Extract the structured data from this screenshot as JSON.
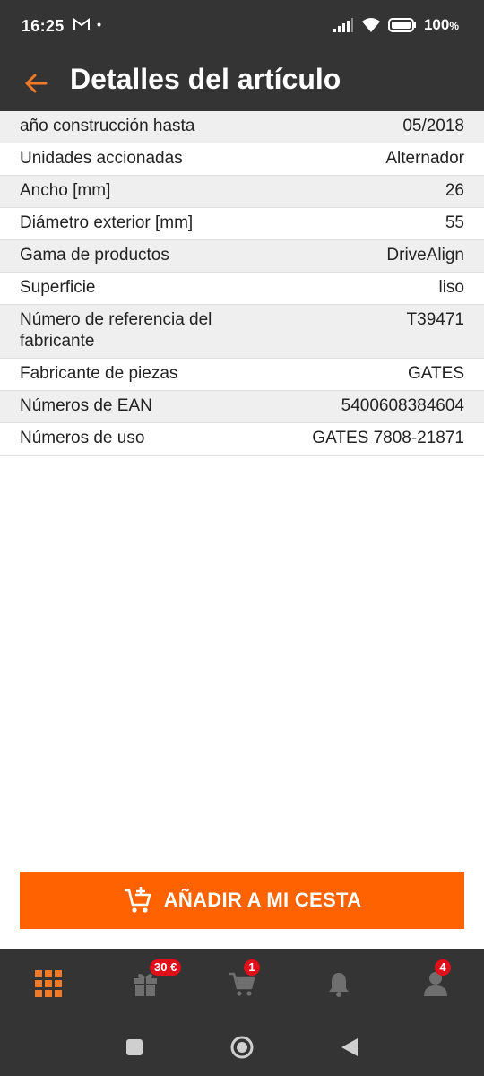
{
  "status_bar": {
    "time": "16:25",
    "battery": "100"
  },
  "header": {
    "title": "Detalles del artículo"
  },
  "details": [
    {
      "label": "año construcción hasta",
      "value": "05/2018"
    },
    {
      "label": "Unidades accionadas",
      "value": "Alternador"
    },
    {
      "label": "Ancho [mm]",
      "value": "26"
    },
    {
      "label": "Diámetro exterior [mm]",
      "value": "55"
    },
    {
      "label": "Gama de productos",
      "value": "DriveAlign"
    },
    {
      "label": "Superficie",
      "value": "liso"
    },
    {
      "label": "Número de referencia del fabricante",
      "value": "T39471"
    },
    {
      "label": "Fabricante de piezas",
      "value": "GATES"
    },
    {
      "label": "Números de EAN",
      "value": "5400608384604"
    },
    {
      "label": "Números de uso",
      "value": "GATES 7808-21871"
    }
  ],
  "add_to_cart": {
    "label": "AÑADIR A MI CESTA",
    "icon": "cart-plus-icon",
    "color": "#ff6200"
  },
  "bottom_nav": {
    "items": [
      {
        "icon": "grid-icon",
        "active": true
      },
      {
        "icon": "gift-icon",
        "badge": "30 €"
      },
      {
        "icon": "cart-icon",
        "badge": "1"
      },
      {
        "icon": "bell-icon"
      },
      {
        "icon": "person-icon",
        "badge": "4"
      }
    ],
    "active_color": "#f07a28",
    "inactive_color": "#6f6f6f"
  },
  "colors": {
    "bar_bg": "#343434",
    "accent": "#ff6200",
    "badge": "#e0101a"
  }
}
